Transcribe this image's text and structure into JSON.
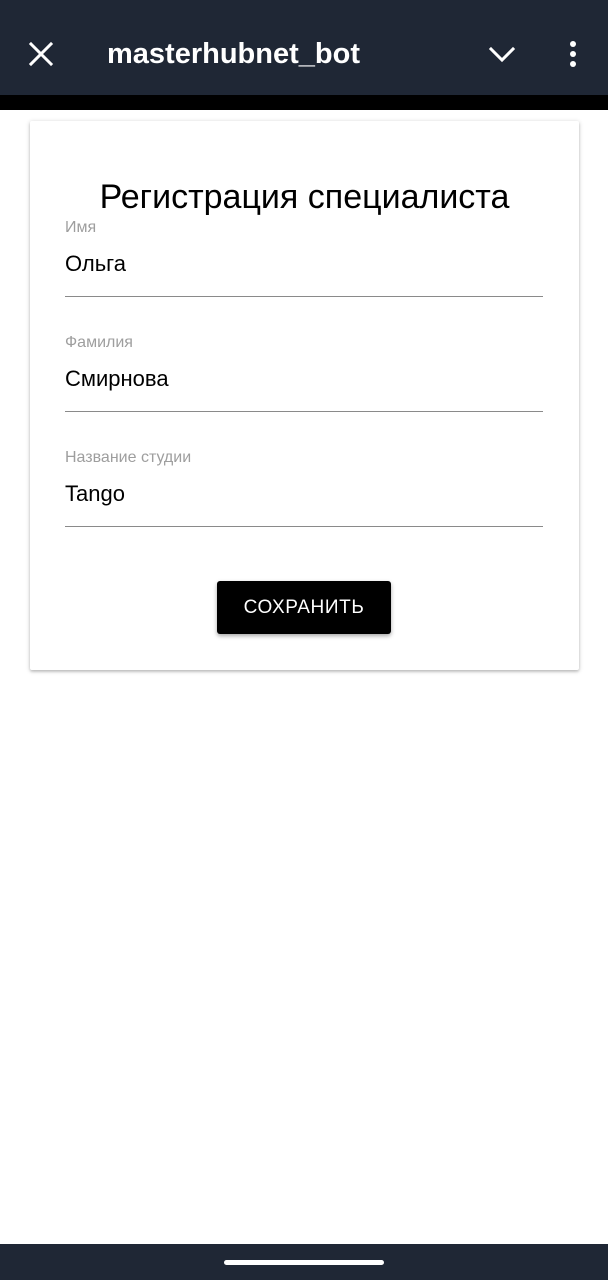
{
  "header": {
    "title": "masterhubnet_bot",
    "close_icon": "close-icon",
    "collapse_icon": "chevron-down-icon",
    "menu_icon": "more-vertical-icon",
    "background_color": "#1f2735"
  },
  "form": {
    "title": "Регистрация специалиста",
    "fields": [
      {
        "label": "Имя",
        "value": "Ольга"
      },
      {
        "label": "Фамилия",
        "value": "Смирнова"
      },
      {
        "label": "Название студии",
        "value": "Tango"
      }
    ],
    "save_label": "СОХРАНИТЬ"
  },
  "navbar": {
    "home_indicator": "home-indicator"
  }
}
